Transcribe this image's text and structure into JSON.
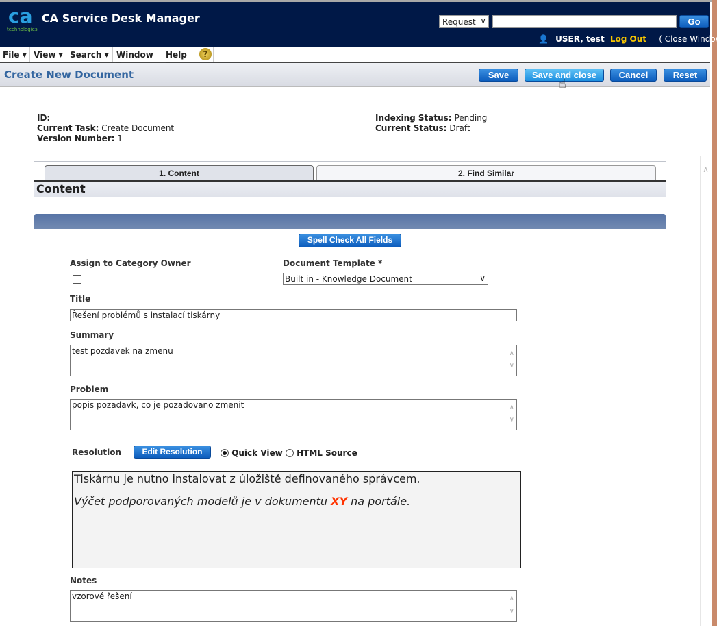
{
  "header": {
    "logo_text": "ca technologies",
    "app_title": "CA Service Desk Manager",
    "search_type": "Request",
    "search_value": "",
    "go_label": "Go",
    "user_name": "USER, test",
    "logout_label": "Log Out",
    "close_window_label": "( Close Window )"
  },
  "menu": {
    "items": [
      {
        "label": "File ▾"
      },
      {
        "label": "View ▾"
      },
      {
        "label": "Search ▾"
      },
      {
        "label": "Window ▾"
      },
      {
        "label": "Help ▾"
      }
    ]
  },
  "titlebar": {
    "page_title": "Create New Document",
    "save_label": "Save",
    "save_close_label": "Save and close",
    "cancel_label": "Cancel",
    "reset_label": "Reset"
  },
  "info": {
    "id_label": "ID:",
    "id_value": "",
    "task_label": "Current Task:",
    "task_value": "Create Document",
    "version_label": "Version Number:",
    "version_value": "1",
    "indexing_label": "Indexing Status:",
    "indexing_value": "Pending",
    "status_label": "Current Status:",
    "status_value": "Draft"
  },
  "tabs": [
    {
      "label": "1. Content",
      "active": true
    },
    {
      "label": "2. Find Similar",
      "active": false
    }
  ],
  "section_title": "Content",
  "form": {
    "spell_check_label": "Spell Check All Fields",
    "assign_label": "Assign to Category Owner",
    "assign_checked": false,
    "template_label": "Document Template *",
    "template_value": "Built in - Knowledge Document",
    "title_label": "Title",
    "title_value": "Řešení problémů s instalací tiskárny",
    "summary_label": "Summary",
    "summary_value": "test pozdavek na zmenu",
    "problem_label": "Problem",
    "problem_value": "popis pozadavk, co je pozadovano zmenit",
    "resolution_label": "Resolution",
    "edit_resolution_label": "Edit Resolution",
    "quick_view_label": "Quick View",
    "html_source_label": "HTML Source",
    "view_mode": "Quick View",
    "resolution_line1": "Tiskárnu je nutno instalovat z úložiště definovaného správcem.",
    "resolution_line2_pre": "Výčet podporovaných modelů je v dokumentu ",
    "resolution_line2_em": "XY",
    "resolution_line2_post": " na portále.",
    "resolution_highlight_color": "#ff3300",
    "notes_label": "Notes",
    "notes_value": "vzorové řešení"
  }
}
